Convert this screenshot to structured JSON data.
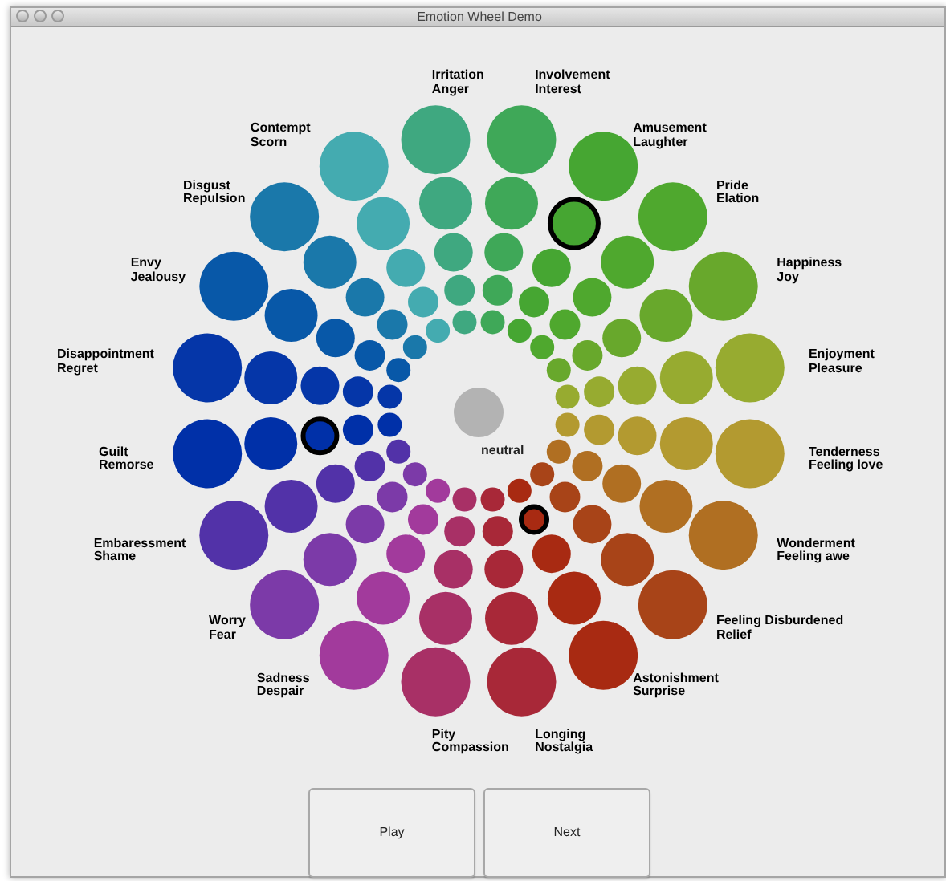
{
  "window": {
    "title": "Emotion Wheel Demo"
  },
  "left_spokes": [
    {
      "labels": [
        "Irritation",
        "Anger"
      ],
      "color": "#3fa880",
      "circles": [
        {
          "selected": false
        },
        {
          "selected": false
        },
        {
          "selected": false
        },
        {
          "selected": false
        },
        {
          "selected": false
        }
      ]
    },
    {
      "labels": [
        "Contempt",
        "Scorn"
      ],
      "color": "#44abb0",
      "circles": [
        {
          "selected": false
        },
        {
          "selected": false
        },
        {
          "selected": false
        },
        {
          "selected": false
        },
        {
          "selected": false
        }
      ]
    },
    {
      "labels": [
        "Disgust",
        "Repulsion"
      ],
      "color": "#1a78aa",
      "circles": [
        {
          "selected": false
        },
        {
          "selected": false
        },
        {
          "selected": false
        },
        {
          "selected": false
        },
        {
          "selected": false
        }
      ]
    },
    {
      "labels": [
        "Envy",
        "Jealousy"
      ],
      "color": "#0858a8",
      "circles": [
        {
          "selected": false
        },
        {
          "selected": false
        },
        {
          "selected": false
        },
        {
          "selected": false
        },
        {
          "selected": false
        }
      ]
    },
    {
      "labels": [
        "Disappointment",
        "Regret"
      ],
      "color": "#0536a8",
      "circles": [
        {
          "selected": false
        },
        {
          "selected": false
        },
        {
          "selected": false
        },
        {
          "selected": false
        },
        {
          "selected": false
        }
      ]
    },
    {
      "labels": [
        "Guilt",
        "Remorse"
      ],
      "color": "#0030a8",
      "circles": [
        {
          "selected": false
        },
        {
          "selected": false
        },
        {
          "selected": true
        },
        {
          "selected": false
        },
        {
          "selected": false
        }
      ]
    },
    {
      "labels": [
        "Embaressment",
        "Shame"
      ],
      "color": "#5232a8",
      "circles": [
        {
          "selected": false
        },
        {
          "selected": false
        },
        {
          "selected": false
        },
        {
          "selected": false
        },
        {
          "selected": false
        }
      ]
    },
    {
      "labels": [
        "Worry",
        "Fear"
      ],
      "color": "#7c3aa8",
      "circles": [
        {
          "selected": false
        },
        {
          "selected": false
        },
        {
          "selected": false
        },
        {
          "selected": false
        },
        {
          "selected": false
        }
      ]
    },
    {
      "labels": [
        "Sadness",
        "Despair"
      ],
      "color": "#a23a9c",
      "circles": [
        {
          "selected": false
        },
        {
          "selected": false
        },
        {
          "selected": false
        },
        {
          "selected": false
        },
        {
          "selected": false
        }
      ]
    },
    {
      "labels": [
        "Pity",
        "Compassion"
      ],
      "color": "#a83066",
      "circles": [
        {
          "selected": false
        },
        {
          "selected": false
        },
        {
          "selected": false
        },
        {
          "selected": false
        },
        {
          "selected": false
        }
      ]
    }
  ],
  "right_spokes": [
    {
      "labels": [
        "Involvement",
        "Interest"
      ],
      "color": "#3fa858",
      "circles": [
        {
          "selected": false
        },
        {
          "selected": false
        },
        {
          "selected": false
        },
        {
          "selected": false
        },
        {
          "selected": false
        }
      ]
    },
    {
      "labels": [
        "Amusement",
        "Laughter"
      ],
      "color": "#46a632",
      "circles": [
        {
          "selected": false
        },
        {
          "selected": true
        },
        {
          "selected": false
        },
        {
          "selected": false
        },
        {
          "selected": false
        }
      ]
    },
    {
      "labels": [
        "Pride",
        "Elation"
      ],
      "color": "#4fa82e",
      "circles": [
        {
          "selected": false
        },
        {
          "selected": false
        },
        {
          "selected": false
        },
        {
          "selected": false
        },
        {
          "selected": false
        }
      ]
    },
    {
      "labels": [
        "Happiness",
        "Joy"
      ],
      "color": "#68a82c",
      "circles": [
        {
          "selected": false
        },
        {
          "selected": false
        },
        {
          "selected": false
        },
        {
          "selected": false
        },
        {
          "selected": false
        }
      ]
    },
    {
      "labels": [
        "Enjoyment",
        "Pleasure"
      ],
      "color": "#97ab30",
      "circles": [
        {
          "selected": false
        },
        {
          "selected": false
        },
        {
          "selected": false
        },
        {
          "selected": false
        },
        {
          "selected": false
        }
      ]
    },
    {
      "labels": [
        "Tenderness",
        "Feeling love"
      ],
      "color": "#b39a30",
      "circles": [
        {
          "selected": false
        },
        {
          "selected": false
        },
        {
          "selected": false
        },
        {
          "selected": false
        },
        {
          "selected": false
        }
      ]
    },
    {
      "labels": [
        "Wonderment",
        "Feeling awe"
      ],
      "color": "#b06f22",
      "circles": [
        {
          "selected": false
        },
        {
          "selected": false
        },
        {
          "selected": false
        },
        {
          "selected": false
        },
        {
          "selected": false
        }
      ]
    },
    {
      "labels": [
        "Feeling Disburdened",
        "Relief"
      ],
      "color": "#a84418",
      "circles": [
        {
          "selected": false
        },
        {
          "selected": false
        },
        {
          "selected": false
        },
        {
          "selected": false
        },
        {
          "selected": false
        }
      ]
    },
    {
      "labels": [
        "Astonishment",
        "Surprise"
      ],
      "color": "#a82a12",
      "circles": [
        {
          "selected": false
        },
        {
          "selected": false
        },
        {
          "selected": false
        },
        {
          "selected": true
        },
        {
          "selected": false
        }
      ]
    },
    {
      "labels": [
        "Longing",
        "Nostalgia"
      ],
      "color": "#a82838",
      "circles": [
        {
          "selected": false
        },
        {
          "selected": false
        },
        {
          "selected": false
        },
        {
          "selected": false
        },
        {
          "selected": false
        }
      ]
    }
  ],
  "neutral": {
    "label": "neutral"
  },
  "buttons": [
    "Play",
    "Next"
  ]
}
